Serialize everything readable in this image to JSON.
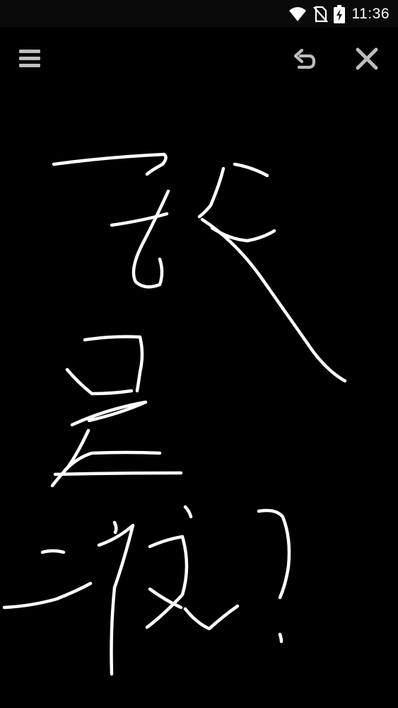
{
  "status_bar": {
    "time": "11:36",
    "icons": [
      "wifi-icon",
      "no-sim-icon",
      "battery-charging-icon"
    ]
  },
  "toolbar": {
    "icons": [
      "menu-icon",
      "undo-icon",
      "close-icon"
    ]
  },
  "colors": {
    "background": "#000000",
    "status_bar": "#0a0a0a",
    "icon": "#bdbdbd",
    "ink": "#ffffff"
  }
}
